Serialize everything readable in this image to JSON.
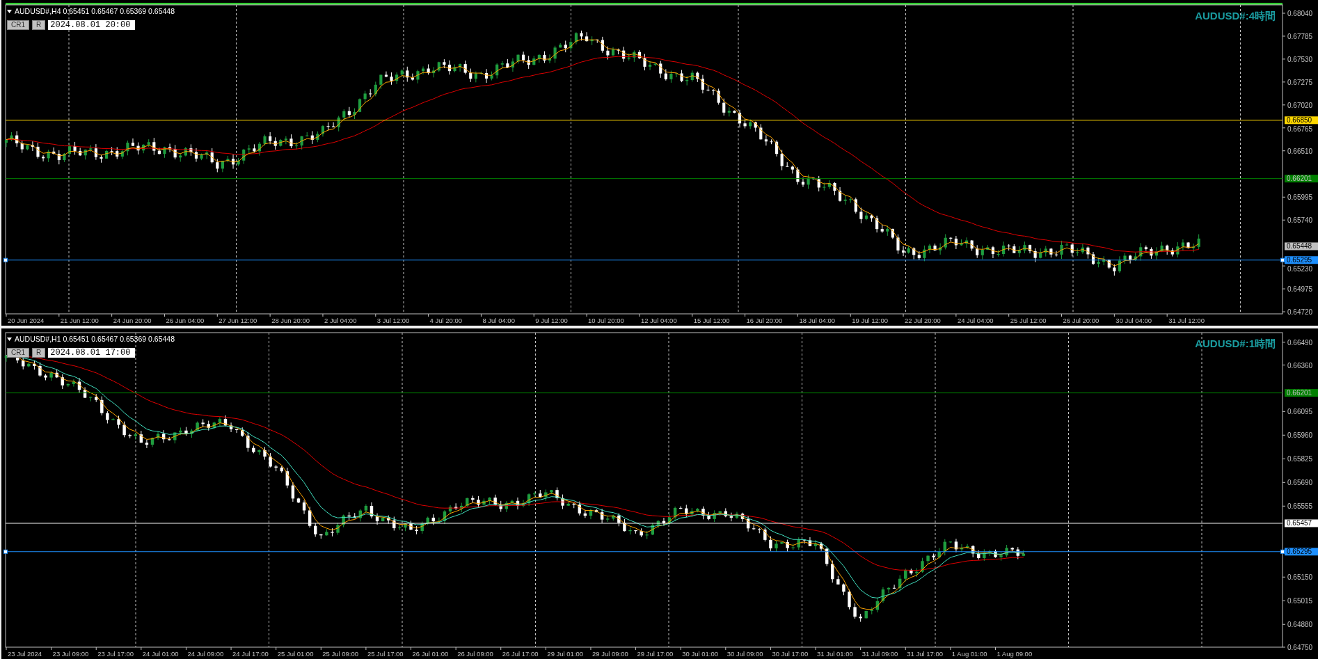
{
  "charts": [
    {
      "active": true,
      "header": {
        "quote": "AUDUSD#,H4  0.65451 0.65467 0.65369 0.65448",
        "buttons": [
          "CR1",
          "R"
        ],
        "date": "2024.08.01 20:00"
      },
      "title": "AUDUSD#:4時間",
      "time_axis": [
        "20 Jun 2024",
        "21 Jun 12:00",
        "24 Jun 20:00",
        "26 Jun 04:00",
        "27 Jun 12:00",
        "28 Jun 20:00",
        "2 Jul 04:00",
        "3 Jul 12:00",
        "4 Jul 20:00",
        "8 Jul 04:00",
        "9 Jul 12:00",
        "10 Jul 20:00",
        "12 Jul 04:00",
        "15 Jul 12:00",
        "16 Jul 20:00",
        "18 Jul 04:00",
        "19 Jul 12:00",
        "22 Jul 20:00",
        "24 Jul 04:00",
        "25 Jul 12:00",
        "26 Jul 20:00",
        "30 Jul 04:00",
        "31 Jul 12:00"
      ],
      "price_axis": [
        "0.68040",
        "0.67785",
        "0.67530",
        "0.67275",
        "0.67020",
        "0.66765",
        "0.66510",
        "0.65995",
        "0.65740",
        "0.65230",
        "0.64975",
        "0.64720"
      ],
      "levels": [
        {
          "kind": "line",
          "price": "0.66850",
          "color": "#ffd700",
          "selected": false
        },
        {
          "kind": "line",
          "price": "0.66201",
          "color": "#008000",
          "selected": false
        },
        {
          "kind": "tag",
          "price": "0.65448",
          "color": "#c0c0c0",
          "selected": false
        },
        {
          "kind": "line",
          "price": "0.65295",
          "color": "#1e90ff",
          "selected": true
        }
      ]
    },
    {
      "active": false,
      "header": {
        "quote": "AUDUSD#,H1  0.65451 0.65467 0.65369 0.65448",
        "buttons": [
          "CR1",
          "R"
        ],
        "date": "2024.08.01 17:00"
      },
      "title": "AUDUSD#:1時間",
      "time_axis": [
        "23 Jul 2024",
        "23 Jul 09:00",
        "23 Jul 17:00",
        "24 Jul 01:00",
        "24 Jul 09:00",
        "24 Jul 17:00",
        "25 Jul 01:00",
        "25 Jul 09:00",
        "25 Jul 17:00",
        "26 Jul 01:00",
        "26 Jul 09:00",
        "26 Jul 17:00",
        "29 Jul 01:00",
        "29 Jul 09:00",
        "29 Jul 17:00",
        "30 Jul 01:00",
        "30 Jul 09:00",
        "30 Jul 17:00",
        "31 Jul 01:00",
        "31 Jul 09:00",
        "31 Jul 17:00",
        "1 Aug 01:00",
        "1 Aug 09:00"
      ],
      "price_axis": [
        "0.66490",
        "0.66360",
        "0.66095",
        "0.65960",
        "0.65825",
        "0.65690",
        "0.65555",
        "0.65150",
        "0.65015",
        "0.64880",
        "0.64750"
      ],
      "levels": [
        {
          "kind": "line",
          "price": "0.66201",
          "color": "#008000",
          "selected": false
        },
        {
          "kind": "line",
          "price": "0.65457",
          "color": "#ffffff",
          "selected": false
        },
        {
          "kind": "line",
          "price": "0.65295",
          "color": "#1e90ff",
          "selected": true
        }
      ]
    }
  ]
}
